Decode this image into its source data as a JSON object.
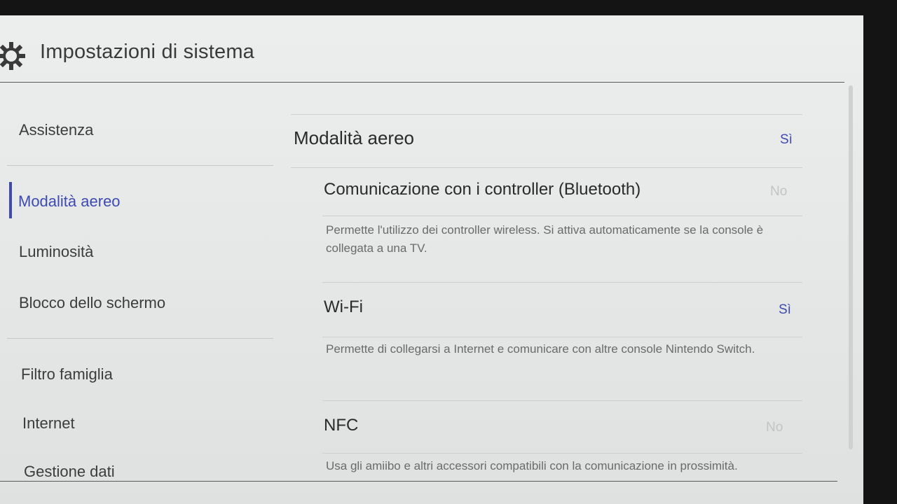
{
  "header": {
    "title": "Impostazioni di sistema",
    "icon": "gear-icon"
  },
  "sidebar": {
    "items": [
      {
        "label": "Assistenza",
        "active": false
      },
      {
        "label": "Modalità aereo",
        "active": true
      },
      {
        "label": "Luminosità",
        "active": false
      },
      {
        "label": "Blocco dello schermo",
        "active": false
      },
      {
        "label": "Filtro famiglia",
        "active": false
      },
      {
        "label": "Internet",
        "active": false
      },
      {
        "label": "Gestione dati",
        "active": false
      }
    ]
  },
  "main": {
    "main_setting": {
      "label": "Modalità aereo",
      "value": "Sì"
    },
    "options": [
      {
        "label": "Comunicazione con i controller (Bluetooth)",
        "value": "No",
        "description": "Permette l'utilizzo dei controller wireless. Si attiva automaticamente se la console è collegata a una TV."
      },
      {
        "label": "Wi-Fi",
        "value": "Sì",
        "description": "Permette di collegarsi a Internet e comunicare con altre console Nintendo Switch."
      },
      {
        "label": "NFC",
        "value": "No",
        "description": "Usa gli amiibo e altri accessori compatibili con la comunicazione in prossimità."
      }
    ]
  },
  "colors": {
    "accent": "#3e4ab0",
    "disabled_value": "#c2c4c4",
    "background": "#e8eaea"
  }
}
